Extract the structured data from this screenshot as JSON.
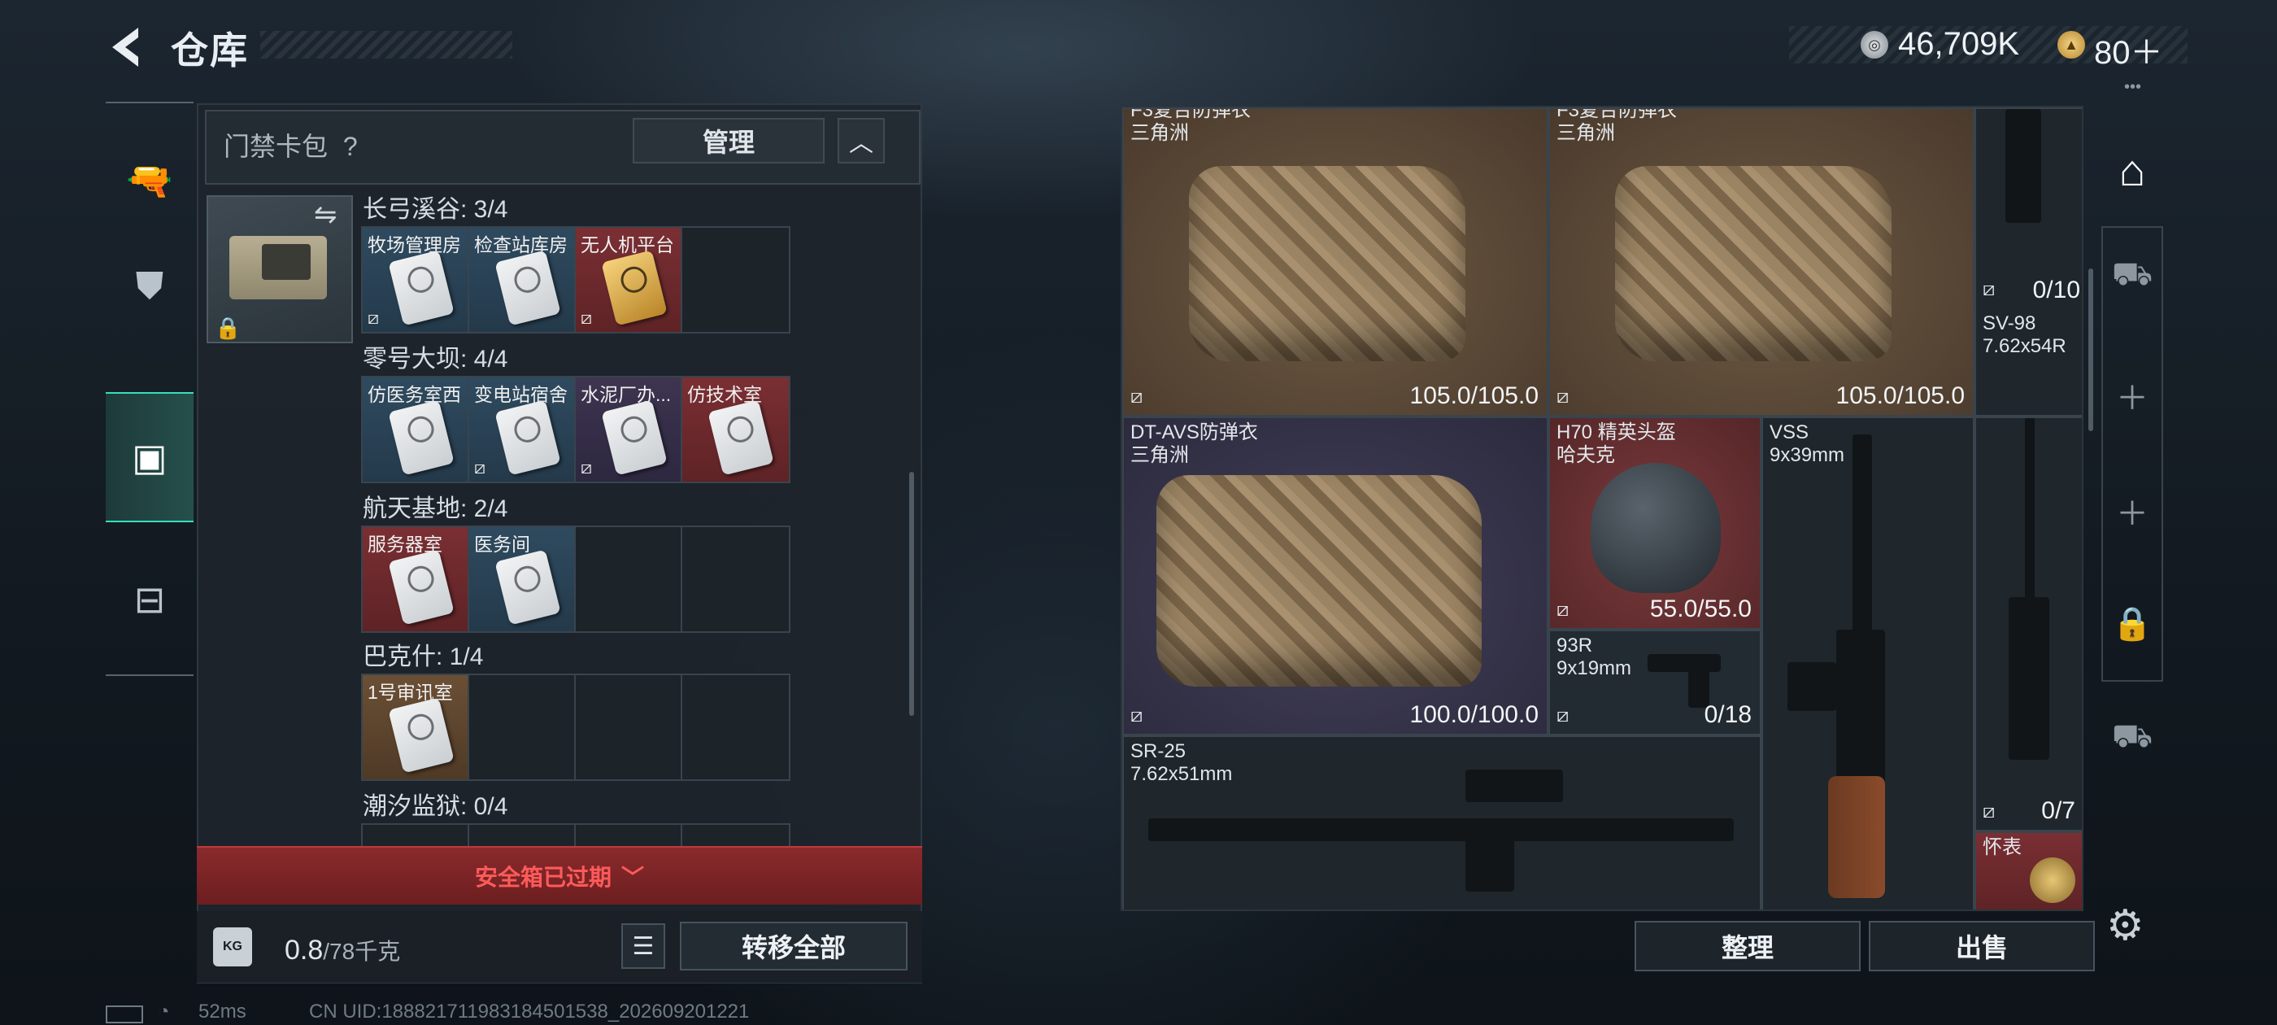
{
  "header": {
    "title": "仓库",
    "currency1": "46,709K",
    "currency2": "80＋"
  },
  "left": {
    "pack_title": "门禁卡包",
    "help": "?",
    "manage_label": "管理",
    "collapse": "︿",
    "sections": [
      {
        "name": "长弓溪谷: 3/4",
        "slots": [
          "牧场管理房",
          "检查站库房",
          "无人机平台",
          ""
        ]
      },
      {
        "name": "零号大坝: 4/4",
        "slots": [
          "仿医务室西",
          "变电站宿舍",
          "水泥厂办...",
          "仿技术室"
        ]
      },
      {
        "name": "航天基地: 2/4",
        "slots": [
          "服务器室",
          "医务间",
          "",
          ""
        ]
      },
      {
        "name": "巴克什: 1/4",
        "slots": [
          "1号审讯室",
          "",
          "",
          ""
        ]
      },
      {
        "name": "潮汐监狱: 0/4",
        "slots": []
      }
    ],
    "expired": "安全箱已过期",
    "weight_value": "0.8",
    "weight_unit": "/78千克",
    "kg_badge": "KG",
    "move_all": "转移全部"
  },
  "status": {
    "ping": "52ms",
    "uid": "CN UID:18882171198318450153​8_202609201221"
  },
  "items": [
    {
      "name": "F3复合防弹衣\n三角洲",
      "value": "105.0/105.0"
    },
    {
      "name": "F3复合防弹衣\n三角洲",
      "value": "105.0/105.0"
    },
    {
      "name": "DT-AVS防弹衣\n三角洲",
      "value": "100.0/100.0"
    },
    {
      "name": "H70 精英头盔\n哈夫克",
      "value": "55.0/55.0"
    },
    {
      "name": "93R\n9x19mm",
      "value": "0/18"
    },
    {
      "name": "VSS\n9x39mm",
      "value": ""
    },
    {
      "name": "SV-98\n7.62x54R",
      "value": "0/10"
    },
    {
      "name": "SR-25\n7.62x51mm",
      "value": ""
    },
    {
      "name": "",
      "value": "0/7"
    },
    {
      "name": "怀表",
      "value": ""
    }
  ],
  "right": {
    "sort_label": "整理",
    "sell_label": "出售",
    "more": "•••"
  }
}
